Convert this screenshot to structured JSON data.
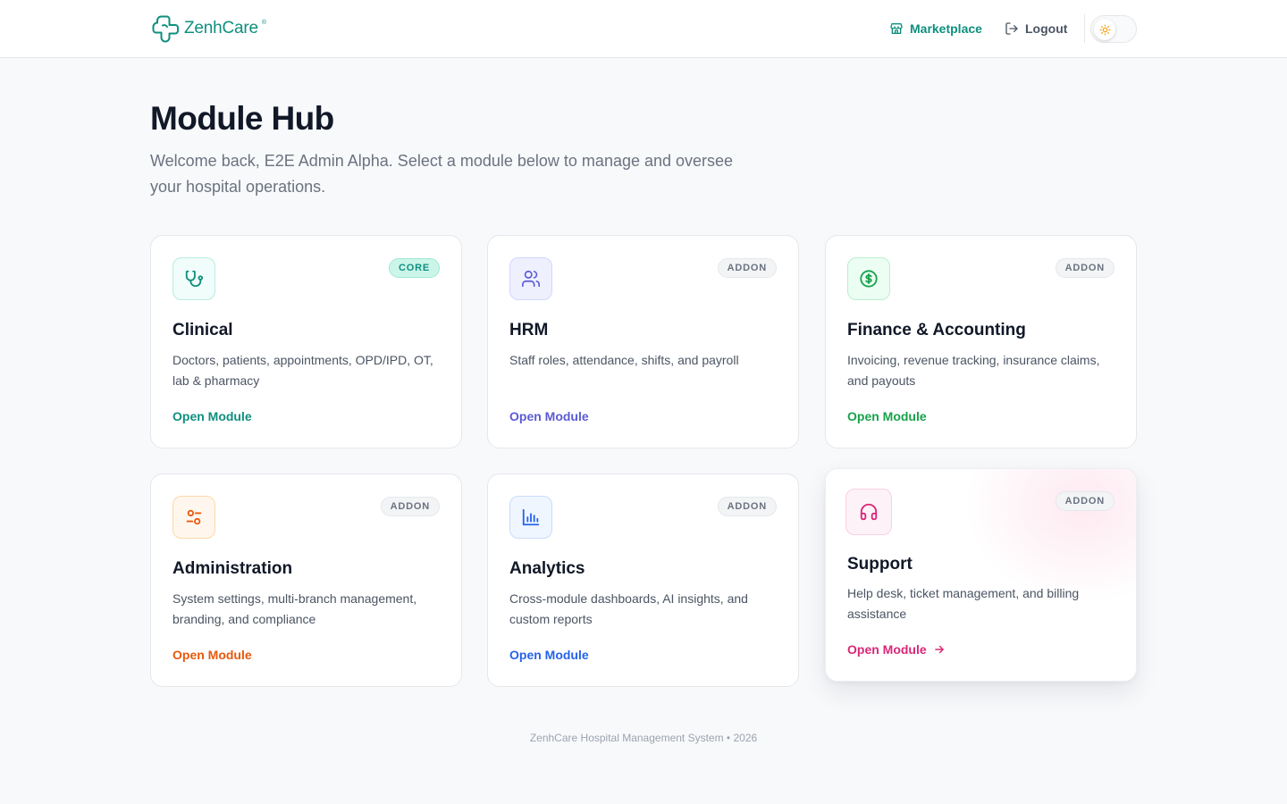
{
  "header": {
    "brand": "ZenhCare",
    "brand_mark": "®",
    "marketplace_label": "Marketplace",
    "logout_label": "Logout"
  },
  "page": {
    "title": "Module Hub",
    "subtitle": "Welcome back, E2E Admin Alpha. Select a module below to manage and oversee your hospital operations."
  },
  "modules": [
    {
      "title": "Clinical",
      "badge": "CORE",
      "description": "Doctors, patients, appointments, OPD/IPD, OT, lab & pharmacy",
      "link": "Open Module",
      "icon": "stethoscope-icon",
      "color": "#0f8f7e"
    },
    {
      "title": "HRM",
      "badge": "ADDON",
      "description": "Staff roles, attendance, shifts, and payroll",
      "link": "Open Module",
      "icon": "users-icon",
      "color": "#5b5bd6"
    },
    {
      "title": "Finance & Accounting",
      "badge": "ADDON",
      "description": "Invoicing, revenue tracking, insurance claims, and payouts",
      "link": "Open Module",
      "icon": "dollar-circle-icon",
      "color": "#16a34a"
    },
    {
      "title": "Administration",
      "badge": "ADDON",
      "description": "System settings, multi-branch management, branding, and compliance",
      "link": "Open Module",
      "icon": "sliders-icon",
      "color": "#ea580c"
    },
    {
      "title": "Analytics",
      "badge": "ADDON",
      "description": "Cross-module dashboards, AI insights, and custom reports",
      "link": "Open Module",
      "icon": "bar-chart-icon",
      "color": "#2563eb"
    },
    {
      "title": "Support",
      "badge": "ADDON",
      "description": "Help desk, ticket management, and billing assistance",
      "link": "Open Module",
      "icon": "headphones-icon",
      "color": "#db2777"
    }
  ],
  "footer": {
    "text": "ZenhCare Hospital Management System • 2026"
  }
}
